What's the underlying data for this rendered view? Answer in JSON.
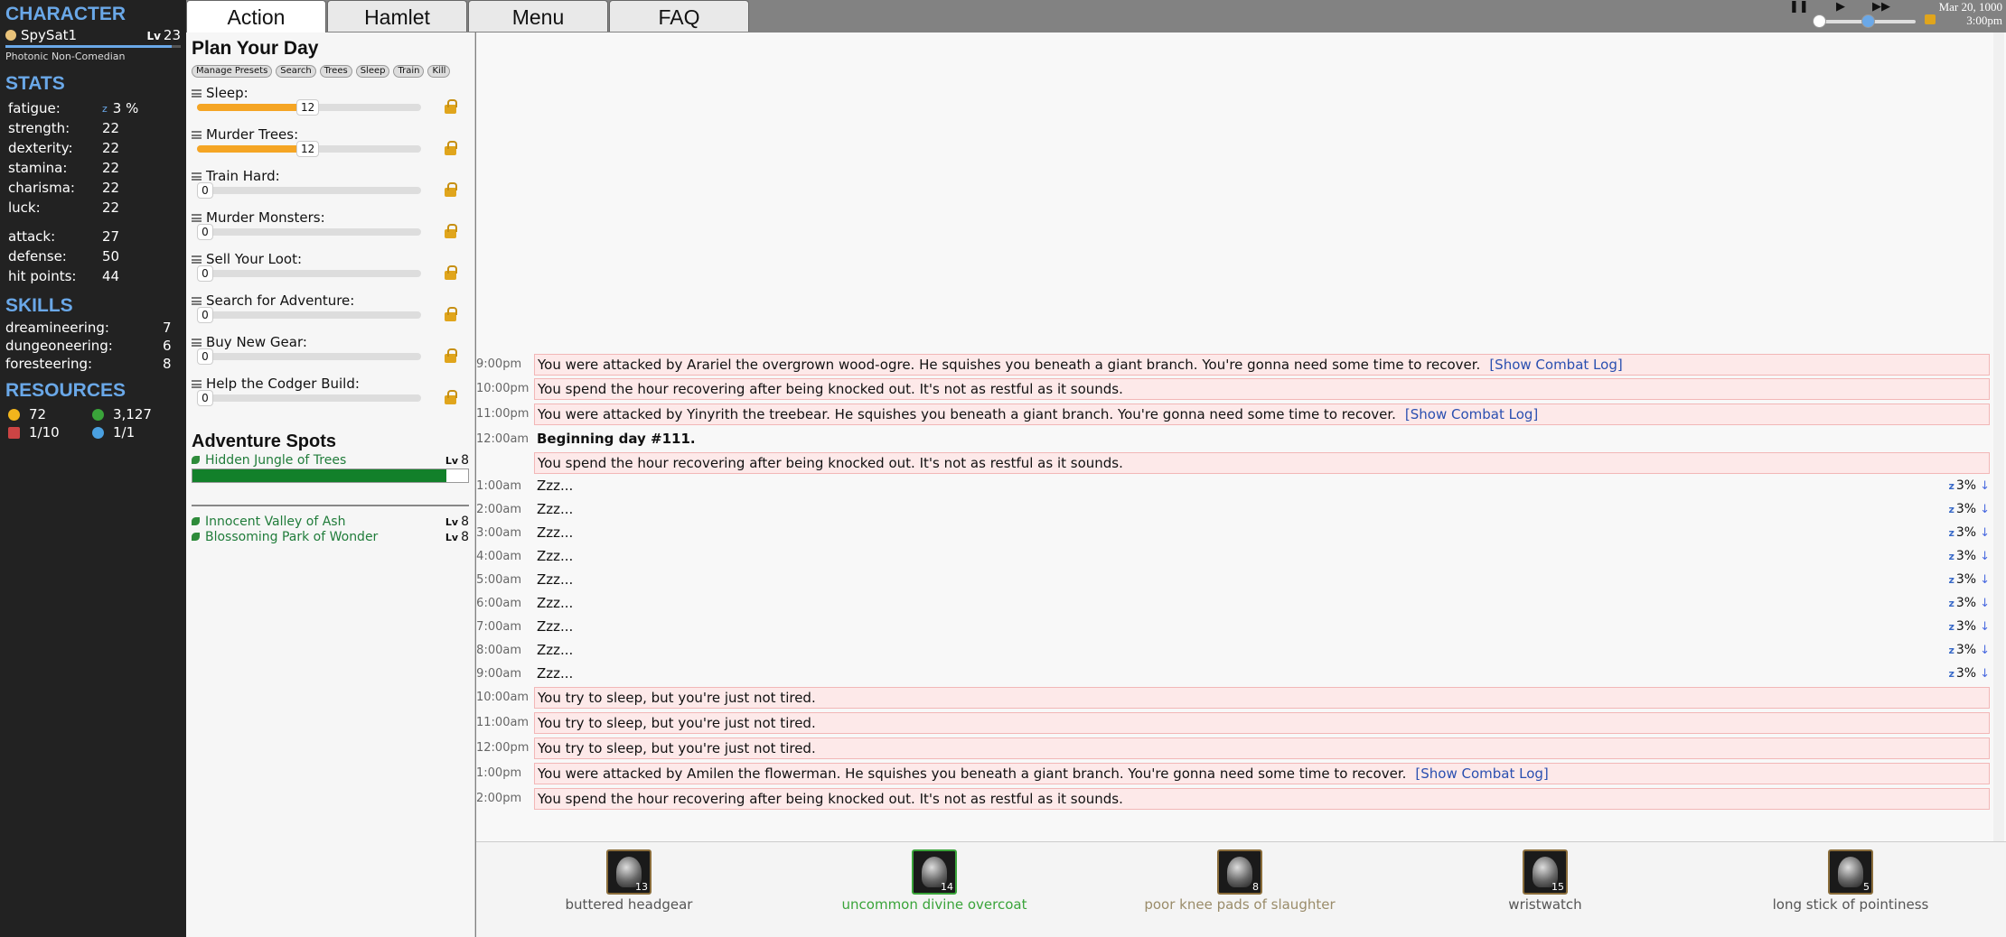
{
  "sidebar": {
    "character_heading": "CHARACTER",
    "name": "SpySat1",
    "level_label": "Lv",
    "level": "23",
    "title": "Photonic Non-Comedian",
    "stats_heading": "STATS",
    "fatigue_label": "fatigue:",
    "fatigue_value": "3 %",
    "stats": [
      {
        "k": "strength:",
        "v": "22"
      },
      {
        "k": "dexterity:",
        "v": "22"
      },
      {
        "k": "stamina:",
        "v": "22"
      },
      {
        "k": "charisma:",
        "v": "22"
      },
      {
        "k": "luck:",
        "v": "22"
      }
    ],
    "combat": [
      {
        "k": "attack:",
        "v": "27"
      },
      {
        "k": "defense:",
        "v": "50"
      },
      {
        "k": "hit points:",
        "v": "44"
      }
    ],
    "skills_heading": "SKILLS",
    "skills": [
      {
        "k": "dreamineering:",
        "v": "7"
      },
      {
        "k": "dungeoneering:",
        "v": "6"
      },
      {
        "k": "foresteering:",
        "v": "8"
      }
    ],
    "resources_heading": "RESOURCES",
    "gold": "72",
    "wood": "3,127",
    "inventory": "1/10",
    "party": "1/1"
  },
  "tabs": [
    "Action",
    "Hamlet",
    "Menu",
    "FAQ"
  ],
  "clock": {
    "date": "Mar 20, 1000",
    "time": "3:00pm"
  },
  "plan": {
    "heading": "Plan Your Day",
    "buttons": [
      "Manage Presets",
      "Search",
      "Trees",
      "Sleep",
      "Train",
      "Kill"
    ],
    "activities": [
      {
        "label": "Sleep:",
        "value": "12",
        "fill": 0.5
      },
      {
        "label": "Murder Trees:",
        "value": "12",
        "fill": 0.5
      },
      {
        "label": "Train Hard:",
        "value": "0",
        "fill": 0
      },
      {
        "label": "Murder Monsters:",
        "value": "0",
        "fill": 0
      },
      {
        "label": "Sell Your Loot:",
        "value": "0",
        "fill": 0
      },
      {
        "label": "Search for Adventure:",
        "value": "0",
        "fill": 0
      },
      {
        "label": "Buy New Gear:",
        "value": "0",
        "fill": 0
      },
      {
        "label": "Help the Codger Build:",
        "value": "0",
        "fill": 0
      }
    ],
    "spots_heading": "Adventure Spots",
    "current_spot": {
      "name": "Hidden Jungle of Trees",
      "lv_label": "Lv",
      "lv": "8",
      "progress": 0.92
    },
    "other_spots": [
      {
        "name": "Innocent Valley of Ash",
        "lv_label": "Lv",
        "lv": "8"
      },
      {
        "name": "Blossoming Park of Wonder",
        "lv_label": "Lv",
        "lv": "8"
      }
    ]
  },
  "log": [
    {
      "time": "9:00pm",
      "msg": "You were attacked by Arariel the overgrown wood-ogre. He squishes you beneath a giant branch. You're gonna need some time to recover.",
      "link": "[Show Combat Log]",
      "hl": true
    },
    {
      "time": "10:00pm",
      "msg": "You spend the hour recovering after being knocked out. It's not as restful as it sounds.",
      "hl": true
    },
    {
      "time": "11:00pm",
      "msg": "You were attacked by Yinyrith the treebear. He squishes you beneath a giant branch. You're gonna need some time to recover.",
      "link": "[Show Combat Log]",
      "hl": true
    },
    {
      "time": "12:00am",
      "msg": "Beginning day #111.",
      "bold": true
    },
    {
      "time": "",
      "msg": "You spend the hour recovering after being knocked out. It's not as restful as it sounds.",
      "hl": true
    },
    {
      "time": "1:00am",
      "msg": "Zzz...",
      "fat": "3%"
    },
    {
      "time": "2:00am",
      "msg": "Zzz...",
      "fat": "3%"
    },
    {
      "time": "3:00am",
      "msg": "Zzz...",
      "fat": "3%"
    },
    {
      "time": "4:00am",
      "msg": "Zzz...",
      "fat": "3%"
    },
    {
      "time": "5:00am",
      "msg": "Zzz...",
      "fat": "3%"
    },
    {
      "time": "6:00am",
      "msg": "Zzz...",
      "fat": "3%"
    },
    {
      "time": "7:00am",
      "msg": "Zzz...",
      "fat": "3%"
    },
    {
      "time": "8:00am",
      "msg": "Zzz...",
      "fat": "3%"
    },
    {
      "time": "9:00am",
      "msg": "Zzz...",
      "fat": "3%"
    },
    {
      "time": "10:00am",
      "msg": "You try to sleep, but you're just not tired.",
      "hl": true
    },
    {
      "time": "11:00am",
      "msg": "You try to sleep, but you're just not tired.",
      "hl": true
    },
    {
      "time": "12:00pm",
      "msg": "You try to sleep, but you're just not tired.",
      "hl": true
    },
    {
      "time": "1:00pm",
      "msg": "You were attacked by Amilen the flowerman. He squishes you beneath a giant branch. You're gonna need some time to recover.",
      "link": "[Show Combat Log]",
      "hl": true
    },
    {
      "time": "2:00pm",
      "msg": "You spend the hour recovering after being knocked out. It's not as restful as it sounds.",
      "hl": true
    }
  ],
  "gear": [
    {
      "name": "buttered headgear",
      "level": "13",
      "color": "#555555"
    },
    {
      "name": "uncommon divine overcoat",
      "level": "14",
      "color": "#3aa43a"
    },
    {
      "name": "poor knee pads of slaughter",
      "level": "8",
      "color": "#9a8c6a"
    },
    {
      "name": "wristwatch",
      "level": "15",
      "color": "#555555"
    },
    {
      "name": "long stick of pointiness",
      "level": "5",
      "color": "#555555"
    }
  ]
}
